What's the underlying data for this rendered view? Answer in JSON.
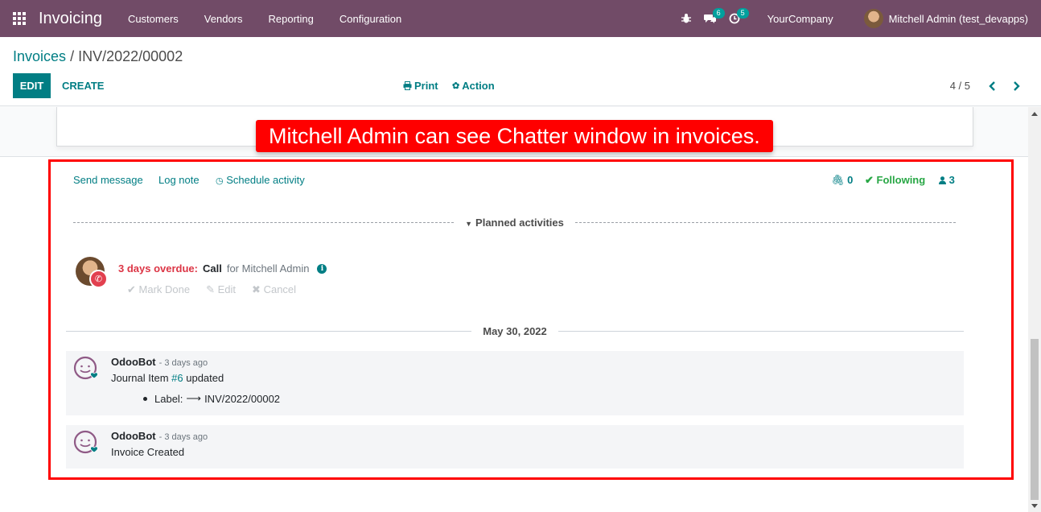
{
  "navbar": {
    "app_name": "Invoicing",
    "menu": [
      "Customers",
      "Vendors",
      "Reporting",
      "Configuration"
    ],
    "messages_badge": "6",
    "activities_badge": "5",
    "company": "YourCompany",
    "user": "Mitchell Admin (test_devapps)",
    "icons": [
      "apps-icon",
      "bug-icon",
      "chat-icon",
      "clock-icon",
      "avatar"
    ]
  },
  "control_panel": {
    "breadcrumb_parent": "Invoices",
    "breadcrumb_separator": "/",
    "breadcrumb_current": "INV/2022/00002",
    "edit_label": "EDIT",
    "create_label": "CREATE",
    "print_label": "Print",
    "action_label": "Action",
    "pager": "4 / 5"
  },
  "annotation": "Mitchell Admin can see Chatter window in invoices.",
  "chatter": {
    "send_message": "Send message",
    "log_note": "Log note",
    "schedule_activity": "Schedule activity",
    "attachments_count": "0",
    "following": "Following",
    "followers_count": "3",
    "planned_title": "Planned activities",
    "activity": {
      "overdue": "3 days overdue:",
      "type": "Call",
      "assigned": "for Mitchell Admin",
      "mark_done": "Mark Done",
      "edit": "Edit",
      "cancel": "Cancel"
    },
    "date_separator": "May 30, 2022",
    "messages": [
      {
        "author": "OdooBot",
        "date": "- 3 days ago",
        "body_prefix": "Journal Item ",
        "body_link": "#6",
        "body_suffix": " updated",
        "change_label": "Label:",
        "change_arrow": "⟶",
        "change_value": "INV/2022/00002"
      },
      {
        "author": "OdooBot",
        "date": "- 3 days ago",
        "body": "Invoice Created"
      }
    ]
  },
  "colors": {
    "navbar": "#714b67",
    "primary": "#017e84",
    "overdue": "#dc3545",
    "following": "#28a745",
    "annotation": "#ff0000"
  }
}
